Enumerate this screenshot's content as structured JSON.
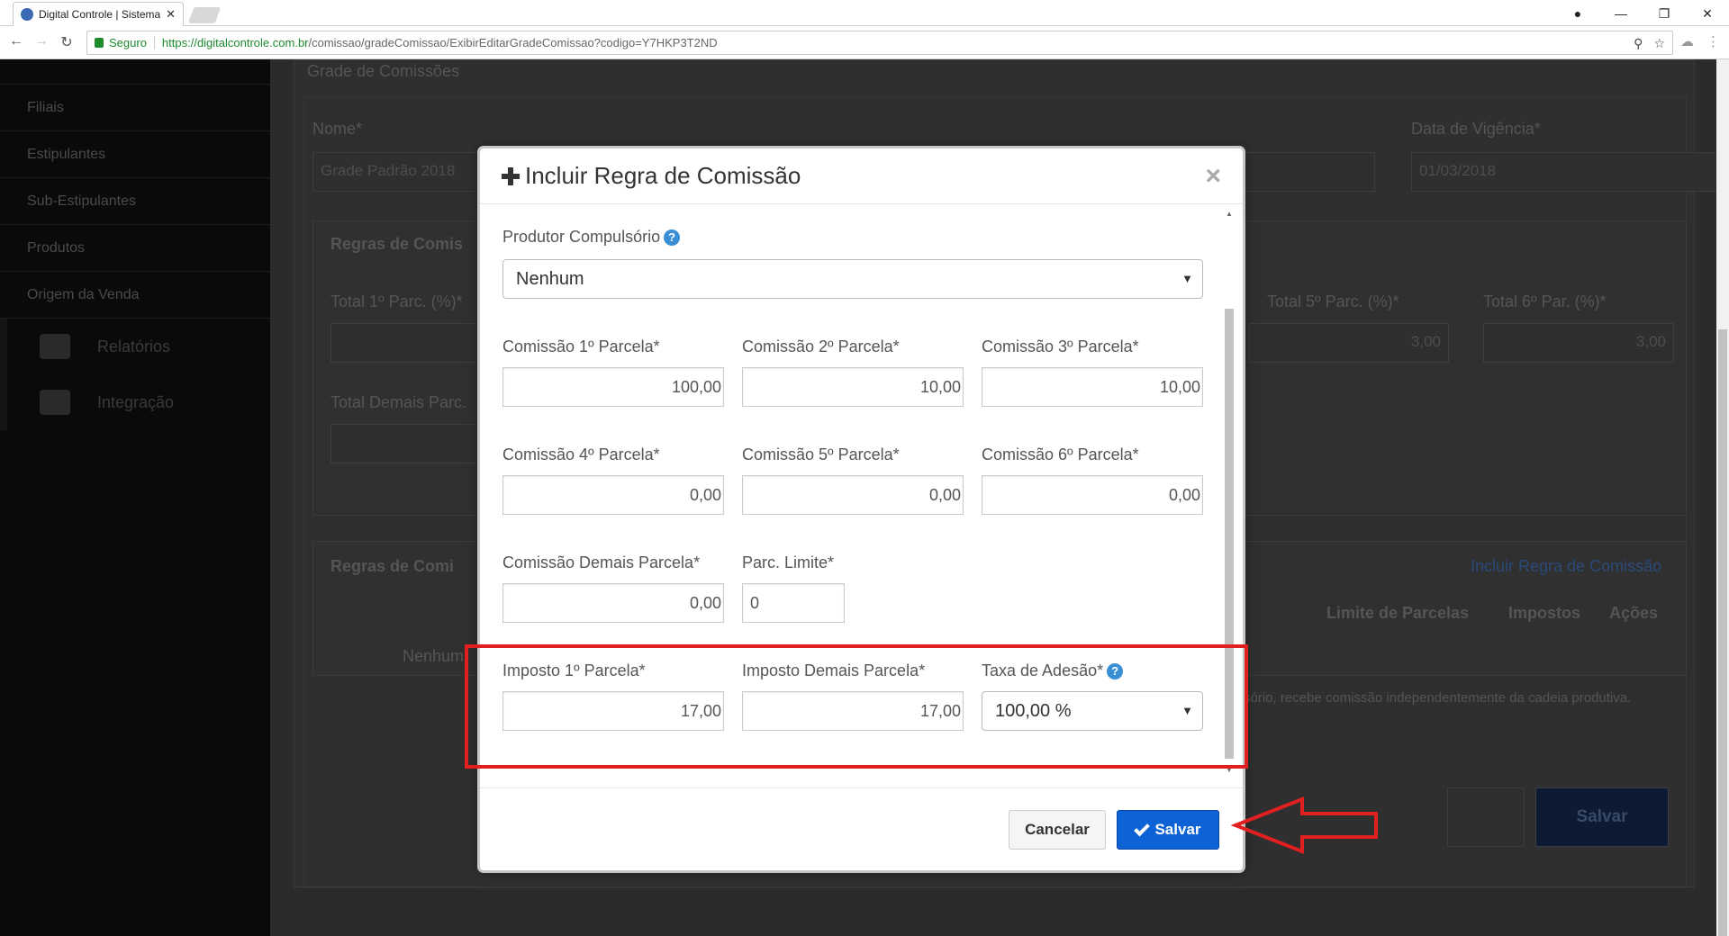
{
  "browser": {
    "tab_title": "Digital Controle | Sistema",
    "secure_label": "Seguro",
    "url_host": "https://digitalcontrole.com.br",
    "url_path": "/comissao/gradeComissao/ExibirEditarGradeComissao?codigo=Y7HKP3T2ND"
  },
  "sidebar": {
    "items": [
      "Filiais",
      "Estipulantes",
      "Sub-Estipulantes",
      "Produtos",
      "Origem da Venda"
    ],
    "sub_items": [
      "Relatórios",
      "Integração"
    ]
  },
  "background": {
    "panel_title": "Grade de Comissões",
    "nome_label": "Nome*",
    "nome_value": "Grade Padrão 2018",
    "vigencia_label": "Data de Vigência*",
    "vigencia_value": "01/03/2018",
    "regras_title_1": "Regras de Comis",
    "total1_label": "Total 1º Parc. (%)*",
    "total5_label": "Total 5º Parc. (%)*",
    "total6_label": "Total 6º Par. (%)*",
    "total5_value": "3,00",
    "total6_value": "3,00",
    "total_demais_label": "Total Demais Parc.",
    "regras_title_2": "Regras de Comi",
    "incluir_link": "Incluir Regra de Comissão",
    "col_limite": "Limite de Parcelas",
    "col_impostos": "Impostos",
    "col_acoes": "Ações",
    "nenhum_row": "Nenhum",
    "note": "sório, recebe comissão independentemente da cadeia produtiva.",
    "save_label": "Salvar"
  },
  "modal": {
    "title": "Incluir Regra de Comissão",
    "close": "×",
    "produtor_label": "Produtor Compulsório",
    "produtor_value": "Nenhum",
    "fields": {
      "c1_label": "Comissão 1º Parcela*",
      "c1_value": "100,00",
      "c2_label": "Comissão 2º Parcela*",
      "c2_value": "10,00",
      "c3_label": "Comissão 3º Parcela*",
      "c3_value": "10,00",
      "c4_label": "Comissão 4º Parcela*",
      "c4_value": "0,00",
      "c5_label": "Comissão 5º Parcela*",
      "c5_value": "0,00",
      "c6_label": "Comissão 6º Parcela*",
      "c6_value": "0,00",
      "cd_label": "Comissão Demais Parcela*",
      "cd_value": "0,00",
      "limite_label": "Parc. Limite*",
      "limite_value": "0",
      "i1_label": "Imposto 1º Parcela*",
      "i1_value": "17,00",
      "id_label": "Imposto Demais Parcela*",
      "id_value": "17,00",
      "taxa_label": "Taxa de Adesão*",
      "taxa_value": "100,00 %"
    },
    "help_glyph": "?",
    "cancel_label": "Cancelar",
    "save_label": "Salvar"
  },
  "colors": {
    "primary": "#0d62d6",
    "annotation": "#e02020",
    "help": "#3a8ed6"
  }
}
